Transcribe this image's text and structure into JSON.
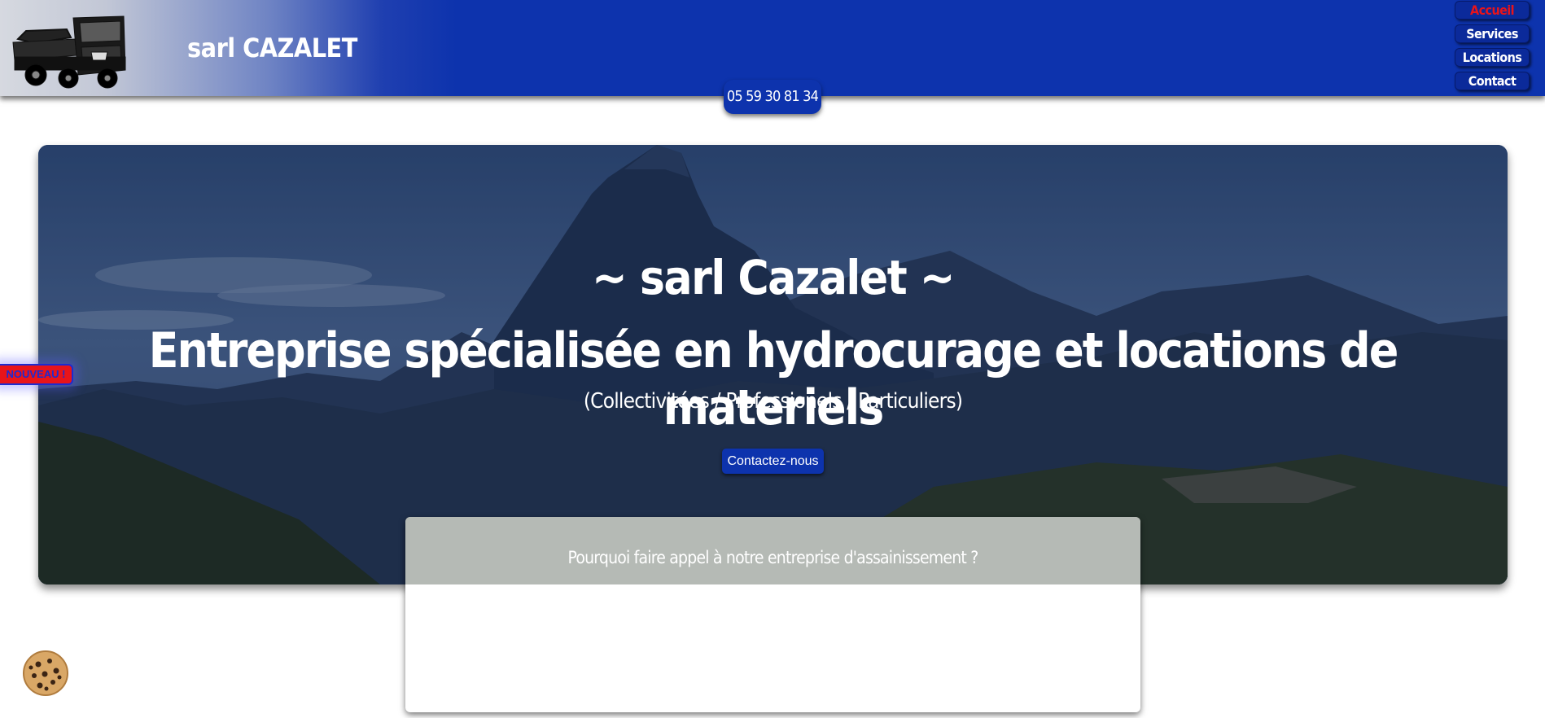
{
  "header": {
    "brand": "sarl CAZALET",
    "logo_icon": "truck-icon",
    "phone": "05 59 30 81 34"
  },
  "nav": {
    "items": [
      {
        "label": "Accueil",
        "active": true
      },
      {
        "label": "Services",
        "active": false
      },
      {
        "label": "Locations",
        "active": false
      },
      {
        "label": "Contact",
        "active": false
      }
    ]
  },
  "hero": {
    "subtitle": "~ sarl Cazalet ~",
    "title": "Entreprise spécialisée en hydrocurage et locations de materiels",
    "audience": "(Collectivitées / Professionels / Particuliers)",
    "cta_label": "Contactez-nous"
  },
  "card": {
    "question": "Pourquoi faire appel à notre entreprise d'assainissement ?"
  },
  "badge": {
    "label": "NOUVEAU !"
  },
  "cookie": {
    "icon": "cookie-icon"
  },
  "colors": {
    "brand_blue": "#0d33ad",
    "active_red": "#e8141a"
  }
}
